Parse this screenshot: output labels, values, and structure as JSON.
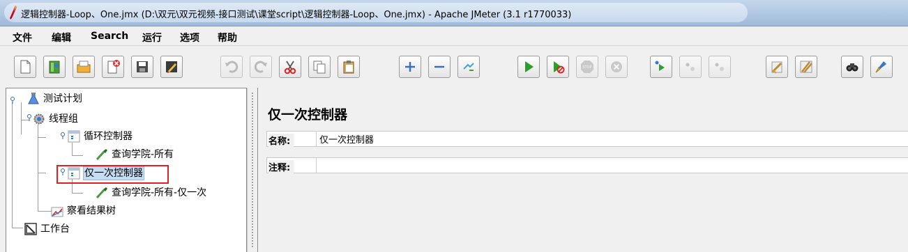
{
  "window": {
    "title": "逻辑控制器-Loop、One.jmx (D:\\双元\\双元视频-接口测试\\课堂script\\逻辑控制器-Loop、One.jmx) - Apache JMeter (3.1 r1770033)"
  },
  "menu": [
    "文件",
    "编辑",
    "Search",
    "运行",
    "选项",
    "帮助"
  ],
  "toolbar": {
    "buttons": [
      "new-icon",
      "templates-icon",
      "open-icon",
      "close-icon",
      "save-icon",
      "save-as-icon",
      "undo-icon",
      "redo-icon",
      "cut-icon",
      "copy-icon",
      "paste-icon",
      "expand-icon",
      "collapse-icon",
      "toggle-icon",
      "start-icon",
      "start-no-pause-icon",
      "stop-icon",
      "shutdown-icon",
      "remote-start-icon",
      "remote-stop-icon",
      "remote-exit-icon",
      "clear-icon",
      "clear-all-icon",
      "search-icon",
      "reset-search-icon"
    ]
  },
  "tree": {
    "test_plan": "测试计划",
    "thread_group": "线程组",
    "loop_controller": "循环控制器",
    "sampler_all": "查询学院-所有",
    "once_controller": "仅一次控制器",
    "sampler_once": "查询学院-所有-仅一次",
    "results_tree": "察看结果树",
    "workbench": "工作台"
  },
  "panel": {
    "title": "仅一次控制器",
    "name_label": "名称:",
    "name_value": "仅一次控制器",
    "comment_label": "注释:",
    "comment_value": ""
  },
  "colors": {
    "selection": "#c5dcf3",
    "highlight_border": "#e02020",
    "titlebar": "#b4cbe6"
  }
}
